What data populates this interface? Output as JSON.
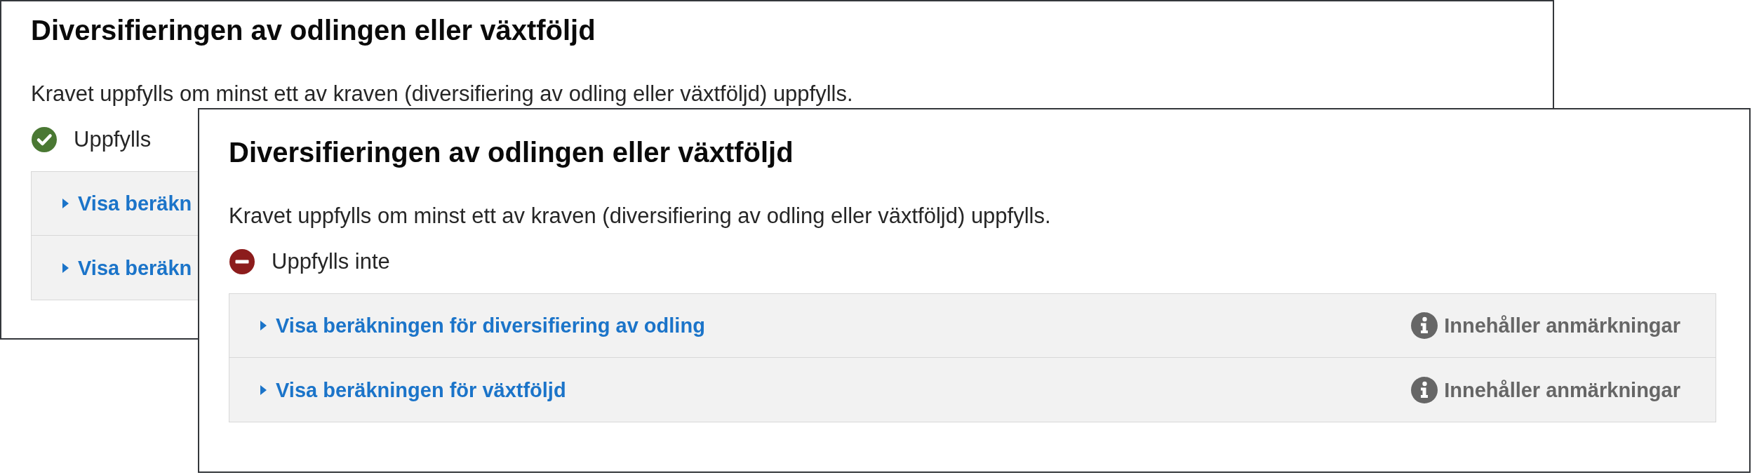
{
  "cards": [
    {
      "title": "Diversifieringen av odlingen eller växtföljd",
      "description": "Kravet uppfylls om minst ett av kraven (diversifiering av odling eller växtföljd) uppfylls.",
      "status": {
        "kind": "met",
        "label": "Uppfylls"
      },
      "calculations": [
        {
          "label": "Visa beräkn",
          "expanded": false
        },
        {
          "label": "Visa beräkn",
          "expanded": false
        }
      ]
    },
    {
      "title": "Diversifieringen av odlingen eller växtföljd",
      "description": "Kravet uppfylls om minst ett av kraven (diversifiering av odling eller växtföljd) uppfylls.",
      "status": {
        "kind": "not_met",
        "label": "Uppfylls inte"
      },
      "calculations": [
        {
          "label": "Visa beräkningen för diversifiering av odling",
          "expanded": false,
          "note": "Innehåller anmärkningar"
        },
        {
          "label": "Visa beräkningen för växtföljd",
          "expanded": false,
          "note": "Innehåller anmärkningar"
        }
      ]
    }
  ]
}
